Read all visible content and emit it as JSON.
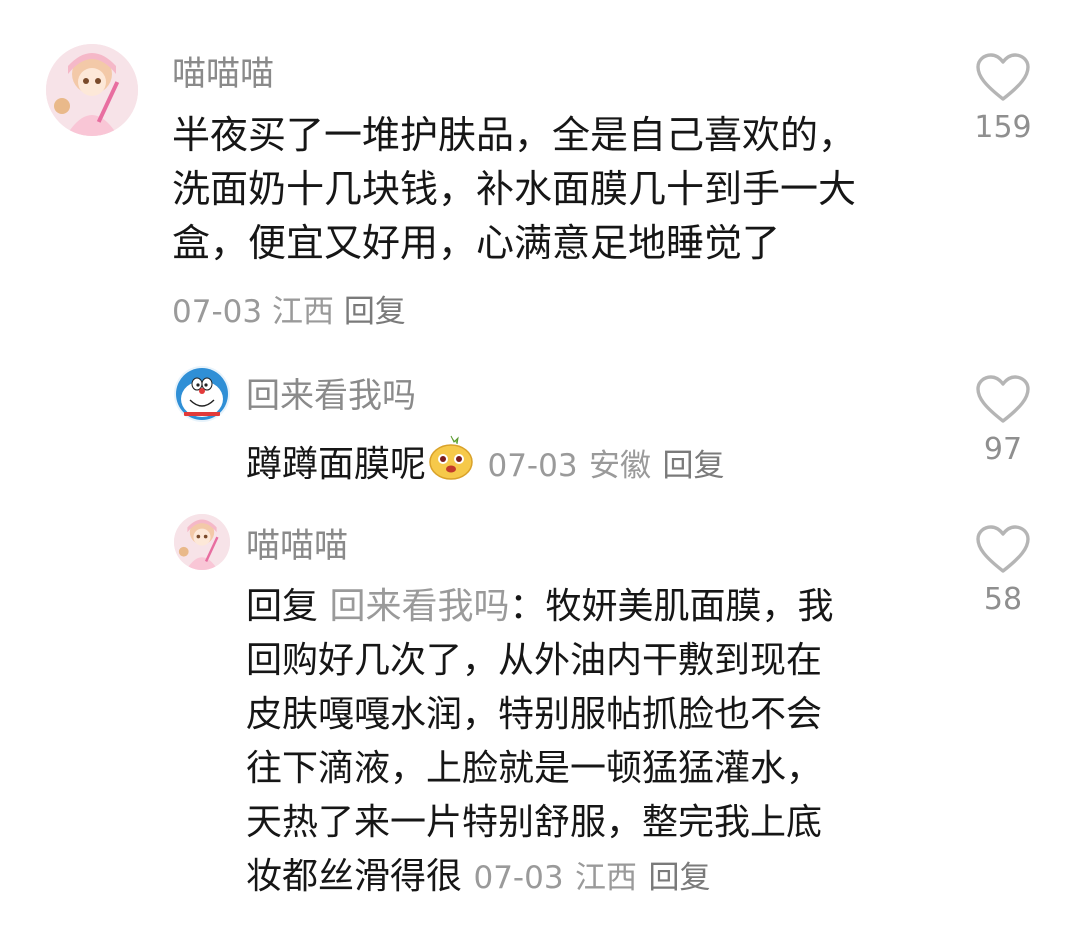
{
  "comments": [
    {
      "username": "喵喵喵",
      "text_lines": [
        "半夜买了一堆护肤品，全是自己喜欢的，",
        "洗面奶十几块钱，补水面膜几十到手一大",
        "盒，便宜又好用，心满意足地睡觉了"
      ],
      "date": "07-03",
      "location": "江西",
      "reply_label": "回复",
      "likes": "159",
      "avatar_icon": "anime-girl-avatar"
    },
    {
      "username": "回来看我吗",
      "text": "蹲蹲面膜呢",
      "emoji_icon": "yellow-blob-emoji",
      "date": "07-03",
      "location": "安徽",
      "reply_label": "回复",
      "likes": "97",
      "avatar_icon": "doraemon-avatar"
    },
    {
      "username": "喵喵喵",
      "reply_prefix": "回复",
      "reply_to": "回来看我吗",
      "reply_colon": "：",
      "first_line_rest": "牧妍美肌面膜，我",
      "text_lines": [
        "回购好几次了，从外油内干敷到现在",
        "皮肤嘎嘎水润，特别服帖抓脸也不会",
        "往下滴液，上脸就是一顿猛猛灌水，",
        "天热了来一片特别舒服，整完我上底"
      ],
      "last_line": "妆都丝滑得很",
      "date": "07-03",
      "location": "江西",
      "reply_label": "回复",
      "likes": "58",
      "avatar_icon": "anime-girl-avatar"
    }
  ],
  "colors": {
    "text": "#161616",
    "meta": "#9a9a9a",
    "username": "#8a8a8a",
    "heart": "#b5b5b5"
  }
}
